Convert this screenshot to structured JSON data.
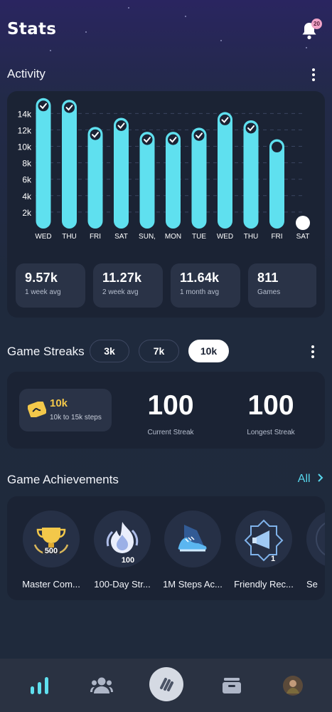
{
  "header": {
    "title": "Stats",
    "notification_count": "20"
  },
  "activity": {
    "title": "Activity",
    "tiles": [
      {
        "value": "9.57k",
        "label": "1 week avg"
      },
      {
        "value": "11.27k",
        "label": "2 week avg"
      },
      {
        "value": "11.64k",
        "label": "1 month avg"
      },
      {
        "value": "811",
        "label": "Games"
      }
    ]
  },
  "chart_data": {
    "type": "bar",
    "categories": [
      "WED",
      "THU",
      "FRI",
      "SAT",
      "SUN,",
      "MON",
      "TUE",
      "WED",
      "THU",
      "FRI",
      "SAT"
    ],
    "values": [
      15000,
      14800,
      11500,
      12600,
      10900,
      10900,
      11400,
      13300,
      12300,
      10000,
      0
    ],
    "goal_met": [
      true,
      true,
      true,
      true,
      true,
      true,
      true,
      true,
      true,
      false,
      false
    ],
    "ylim": [
      0,
      15500
    ],
    "yticks": [
      "14k",
      "12k",
      "10k",
      "8k",
      "6k",
      "4k",
      "2k"
    ],
    "ytick_values": [
      14000,
      12000,
      10000,
      8000,
      6000,
      4000,
      2000
    ],
    "bar_color": "#5fe0ef",
    "grid": true
  },
  "streaks": {
    "title": "Game Streaks",
    "options": [
      "3k",
      "7k",
      "10k"
    ],
    "selected": "10k",
    "badge_value": "10k",
    "badge_label": "10k to 15k steps",
    "current_value": "100",
    "current_label": "Current Streak",
    "longest_value": "100",
    "longest_label": "Longest Streak"
  },
  "achievements": {
    "title": "Game Achievements",
    "all_label": "All",
    "items": [
      {
        "name": "Master Com...",
        "icon": "trophy-icon",
        "badge": "500"
      },
      {
        "name": "100-Day Str...",
        "icon": "flame-icon",
        "badge": "100"
      },
      {
        "name": "1M Steps Ac...",
        "icon": "sneaker-icon",
        "badge": ""
      },
      {
        "name": "Friendly Rec...",
        "icon": "megaphone-icon",
        "badge": "1"
      },
      {
        "name": "Se",
        "icon": "partial-icon",
        "badge": ""
      }
    ]
  },
  "nav": [
    "stats-icon",
    "friends-icon",
    "home-icon",
    "wallet-icon",
    "profile-avatar"
  ],
  "colors": {
    "accent": "#58d6ec",
    "background": "#1f2a3c",
    "card": "#1b2334",
    "highlight": "#f3c84a"
  }
}
